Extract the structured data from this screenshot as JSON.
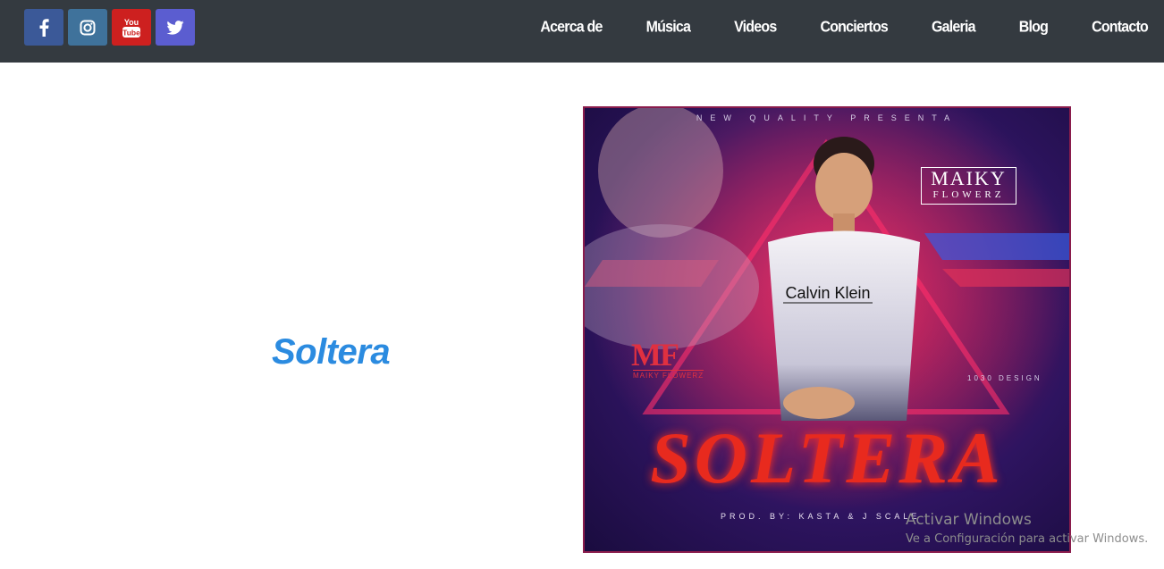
{
  "social": [
    {
      "name": "facebook",
      "icon": "facebook-icon",
      "color": "#3b5998"
    },
    {
      "name": "instagram",
      "icon": "instagram-icon",
      "color": "#3f729b"
    },
    {
      "name": "youtube",
      "icon": "youtube-icon",
      "color": "#cd201f",
      "label_top": "You",
      "label_bottom": "Tube"
    },
    {
      "name": "twitter",
      "icon": "twitter-icon",
      "color": "#5b5dd0"
    }
  ],
  "nav": {
    "items": [
      {
        "label": "Acerca de"
      },
      {
        "label": "Música"
      },
      {
        "label": "Videos"
      },
      {
        "label": "Conciertos"
      },
      {
        "label": "Galeria"
      },
      {
        "label": "Blog"
      },
      {
        "label": "Contacto"
      }
    ]
  },
  "song": {
    "title": "Soltera",
    "title_color": "#2b8be0"
  },
  "cover": {
    "top_text": "NEW QUALITY PRESENTA",
    "brand_line1": "MAIKY",
    "brand_line2": "FLOWERZ",
    "logo_mark": "MF",
    "logo_sub": "MAIKY FLOWERZ",
    "shirt_text": "Calvin Klein",
    "design_credit": "1030 DESIGN",
    "title": "SOLTERA",
    "producer": "PROD. BY: KASTA & J SCALE"
  },
  "watermark": {
    "line1": "Activar Windows",
    "line2": "Ve a Configuración para activar Windows."
  }
}
